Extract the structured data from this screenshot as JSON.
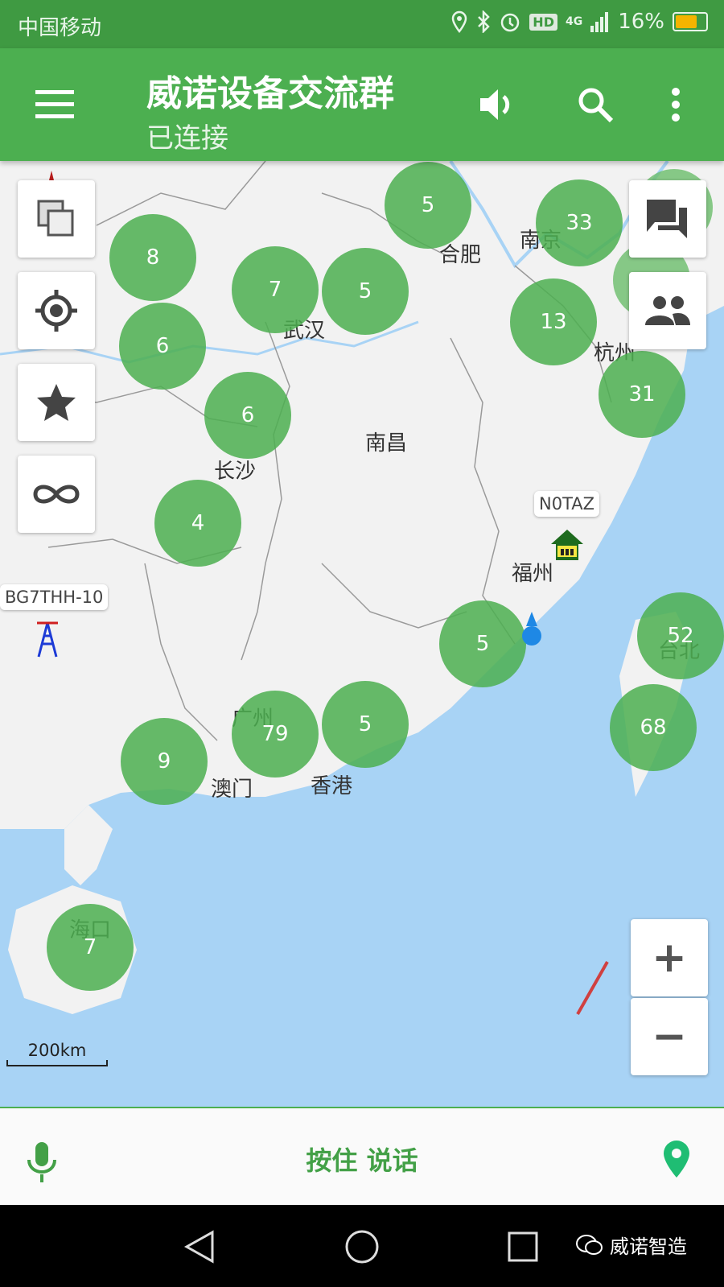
{
  "status_bar": {
    "carrier": "中国移动",
    "network": "4G",
    "hd_badge": "HD",
    "battery": "16%",
    "battery_level": 0.16
  },
  "app_bar": {
    "title": "威诺设备交流群",
    "subtitle": "已连接",
    "icons": [
      "menu-icon",
      "speaker-icon",
      "search-icon",
      "more-vert-icon"
    ]
  },
  "map": {
    "cities": [
      "合肥",
      "南京",
      "武汉",
      "杭州",
      "南昌",
      "长沙",
      "福州",
      "广州",
      "澳门",
      "香港",
      "台北",
      "海口"
    ],
    "clusters": [
      "5",
      "33",
      "8",
      "7",
      "5",
      "13",
      "6",
      "6",
      "31",
      "4",
      "5",
      "52",
      "68",
      "79",
      "5",
      "9",
      "7"
    ],
    "stations": [
      "N0TAZ",
      "BG7THH-10"
    ],
    "scale_label": "200km",
    "left_buttons": [
      "layers-icon",
      "locate-icon",
      "star-icon",
      "infinity-icon"
    ],
    "right_buttons": [
      "chat-icon",
      "group-icon"
    ],
    "zoom_in": "+",
    "zoom_out": "−",
    "colors": {
      "water": "#a8d3f5",
      "land": "#f2f2f2",
      "cluster": "#4caf50"
    }
  },
  "bottom_bar": {
    "push_to_talk": "按住 说话",
    "icons": [
      "mic-icon",
      "location-pin-icon"
    ]
  },
  "nav_bar": {
    "icons": [
      "back-icon",
      "home-icon",
      "recents-icon"
    ],
    "watermark": "威诺智造"
  }
}
